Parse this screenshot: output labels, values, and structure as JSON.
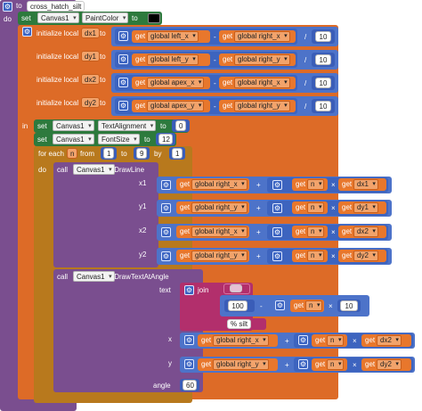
{
  "procedure": {
    "to": "to",
    "name": "cross_hatch_silt",
    "do": "do"
  },
  "paint": {
    "set": "set",
    "component": "Canvas1",
    "prop": "PaintColor",
    "to": "to",
    "color": "#000000"
  },
  "locals": [
    {
      "label": "initialize local",
      "var": "dx1",
      "to": "to",
      "a": "global left_x",
      "b": "global right_x",
      "op": "-",
      "div": "/",
      "n": "10"
    },
    {
      "label": "initialize local",
      "var": "dy1",
      "to": "to",
      "a": "global left_y",
      "b": "global right_y",
      "op": "-",
      "div": "/",
      "n": "10"
    },
    {
      "label": "initialize local",
      "var": "dx2",
      "to": "to",
      "a": "global apex_x",
      "b": "global right_x",
      "op": "-",
      "div": "/",
      "n": "10"
    },
    {
      "label": "initialize local",
      "var": "dy2",
      "to": "to",
      "a": "global apex_y",
      "b": "global right_y",
      "op": "-",
      "div": "/",
      "n": "10"
    }
  ],
  "in_label": "in",
  "set_align": {
    "set": "set",
    "component": "Canvas1",
    "prop": "TextAlignment",
    "to": "to",
    "value": "0"
  },
  "set_font": {
    "set": "set",
    "component": "Canvas1",
    "prop": "FontSize",
    "to": "to",
    "value": "12"
  },
  "loop": {
    "for_each": "for each",
    "var": "n",
    "from": "from",
    "from_val": "1",
    "to": "to",
    "to_val": "9",
    "by": "by",
    "by_val": "1",
    "do": "do"
  },
  "drawline": {
    "call": "call",
    "component": "Canvas1",
    "method": ".DrawLine",
    "rows": [
      {
        "param": "x1",
        "global": "global right_x",
        "plus": "+",
        "get": "get",
        "n": "n",
        "times": "×",
        "var": "dx1"
      },
      {
        "param": "y1",
        "global": "global right_y",
        "plus": "+",
        "get": "get",
        "n": "n",
        "times": "×",
        "var": "dy1"
      },
      {
        "param": "x2",
        "global": "global right_x",
        "plus": "+",
        "get": "get",
        "n": "n",
        "times": "×",
        "var": "dx2"
      },
      {
        "param": "y2",
        "global": "global right_y",
        "plus": "+",
        "get": "get",
        "n": "n",
        "times": "×",
        "var": "dy2"
      }
    ]
  },
  "drawtext": {
    "call": "call",
    "component": "Canvas1",
    "method": ".DrawTextAtAngle",
    "text_param": "text",
    "join": "join",
    "empty_text": "",
    "hundred": "100",
    "minus": "-",
    "get": "get",
    "n": "n",
    "times": "×",
    "ten": "10",
    "pct": "% silt",
    "x_param": "x",
    "x_global": "global right_x",
    "x_var": "dx2",
    "y_param": "y",
    "y_global": "global right_y",
    "y_var": "dy2",
    "plus": "+",
    "angle_param": "angle",
    "angle": "60"
  },
  "colors": {
    "procedure": "#7a4e8f",
    "set": "#2d7a3d",
    "local": "#dd6b27",
    "loop": "#b8791d",
    "call": "#7a4e8f",
    "math": "#4d73c9",
    "text": "#b22f6c"
  }
}
